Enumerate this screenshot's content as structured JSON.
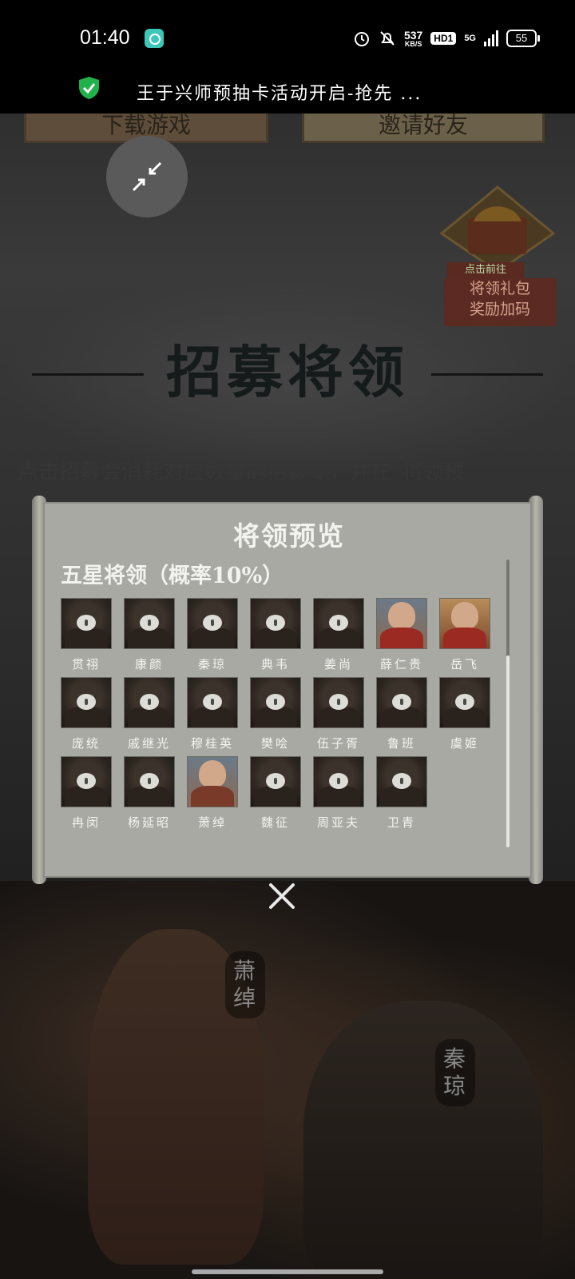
{
  "status_bar": {
    "time": "01:40",
    "speed_value": "537",
    "speed_unit": "KB/S",
    "hd_label": "HD1",
    "network": "5G",
    "battery": "55"
  },
  "notification": {
    "title": "王于兴师预抽卡活动开启-抢先 ..."
  },
  "page": {
    "top_left_button": "下载游戏",
    "top_right_button": "邀请好友",
    "gift_tag": "点击前往",
    "gift_label_line1": "将领礼包",
    "gift_label_line2": "奖励加码",
    "section_title": "招募将领",
    "intro_text": "点击招募会消耗对应数量的招募令，并在“将领预",
    "hero_name_1": "萧绰",
    "hero_name_2": "秦琼"
  },
  "modal": {
    "title": "将领预览",
    "tier_heading": "五星将领（概率10%）",
    "generals": [
      {
        "name": "贯祤",
        "revealed": false
      },
      {
        "name": "康颜",
        "revealed": false
      },
      {
        "name": "秦琼",
        "revealed": false
      },
      {
        "name": "典韦",
        "revealed": false
      },
      {
        "name": "姜尚",
        "revealed": false
      },
      {
        "name": "薛仁贵",
        "revealed": true
      },
      {
        "name": "岳飞",
        "revealed": true
      },
      {
        "name": "庞统",
        "revealed": false
      },
      {
        "name": "戚继光",
        "revealed": false
      },
      {
        "name": "穆桂英",
        "revealed": false
      },
      {
        "name": "樊哙",
        "revealed": false
      },
      {
        "name": "伍子胥",
        "revealed": false
      },
      {
        "name": "鲁班",
        "revealed": false
      },
      {
        "name": "虞姬",
        "revealed": false
      },
      {
        "name": "冉闵",
        "revealed": false
      },
      {
        "name": "杨延昭",
        "revealed": false
      },
      {
        "name": "萧绰",
        "revealed": true
      },
      {
        "name": "魏征",
        "revealed": false
      },
      {
        "name": "周亚夫",
        "revealed": false
      },
      {
        "name": "卫青",
        "revealed": false
      }
    ]
  },
  "colors": {
    "accent_green": "#3cc7b8",
    "shield_green": "#22b24c"
  }
}
